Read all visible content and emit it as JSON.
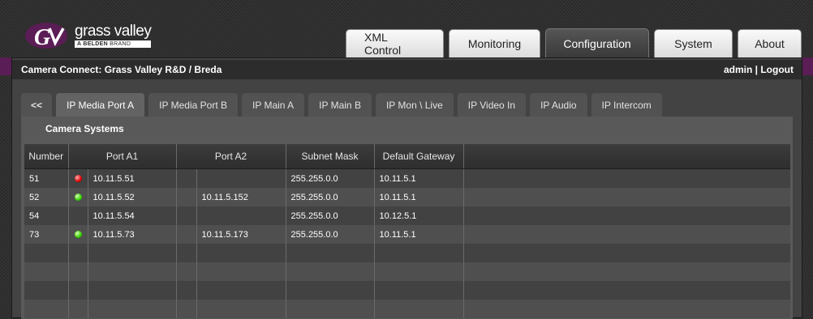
{
  "brand": {
    "name": "grass valley",
    "tagline_strong": "A BELDEN",
    "tagline_thin": "BRAND",
    "icon": "grass-valley-logo"
  },
  "main_tabs": [
    {
      "label": "XML Control",
      "active": false
    },
    {
      "label": "Monitoring",
      "active": false
    },
    {
      "label": "Configuration",
      "active": true
    },
    {
      "label": "System",
      "active": false
    },
    {
      "label": "About",
      "active": false
    }
  ],
  "info_bar": {
    "title": "Camera Connect: Grass Valley R&D / Breda",
    "user": "admin",
    "separator": "|",
    "logout": "Logout"
  },
  "sub_tabs": [
    {
      "label": "<<",
      "active": false
    },
    {
      "label": "IP Media Port A",
      "active": true
    },
    {
      "label": "IP Media Port B",
      "active": false
    },
    {
      "label": "IP Main A",
      "active": false
    },
    {
      "label": "IP Main B",
      "active": false
    },
    {
      "label": "IP Mon \\ Live",
      "active": false
    },
    {
      "label": "IP Video In",
      "active": false
    },
    {
      "label": "IP Audio",
      "active": false
    },
    {
      "label": "IP Intercom",
      "active": false
    }
  ],
  "section_title": "Camera Systems",
  "table": {
    "headers": {
      "number": "Number",
      "port_a1": "Port A1",
      "port_a2": "Port A2",
      "subnet": "Subnet Mask",
      "gateway": "Default Gateway"
    },
    "rows": [
      {
        "number": "51",
        "status": "red",
        "port_a1": "10.11.5.51",
        "port_a2": "",
        "subnet": "255.255.0.0",
        "gateway": "10.11.5.1"
      },
      {
        "number": "52",
        "status": "green",
        "port_a1": "10.11.5.52",
        "port_a2": "10.11.5.152",
        "subnet": "255.255.0.0",
        "gateway": "10.11.5.1"
      },
      {
        "number": "54",
        "status": "none",
        "port_a1": "10.11.5.54",
        "port_a2": "",
        "subnet": "255.255.0.0",
        "gateway": "10.12.5.1"
      },
      {
        "number": "73",
        "status": "green",
        "port_a1": "10.11.5.73",
        "port_a2": "10.11.5.173",
        "subnet": "255.255.0.0",
        "gateway": "10.11.5.1"
      }
    ],
    "empty_rows": 4
  },
  "colors": {
    "accent_purple": "#5b1d55",
    "led_red": "#e10000",
    "led_green": "#33d000"
  }
}
